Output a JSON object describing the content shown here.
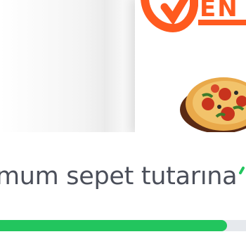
{
  "promo_banner": {
    "logo_text": "EN S",
    "accent_color": "#ff5a1f",
    "image_icon": "pizza-icon"
  },
  "minimum_basket": {
    "message": "mum sepet tutarına",
    "status_icon": "checkmark-icon",
    "progress_fraction": 0.9,
    "progress_color": "#22c55e"
  }
}
